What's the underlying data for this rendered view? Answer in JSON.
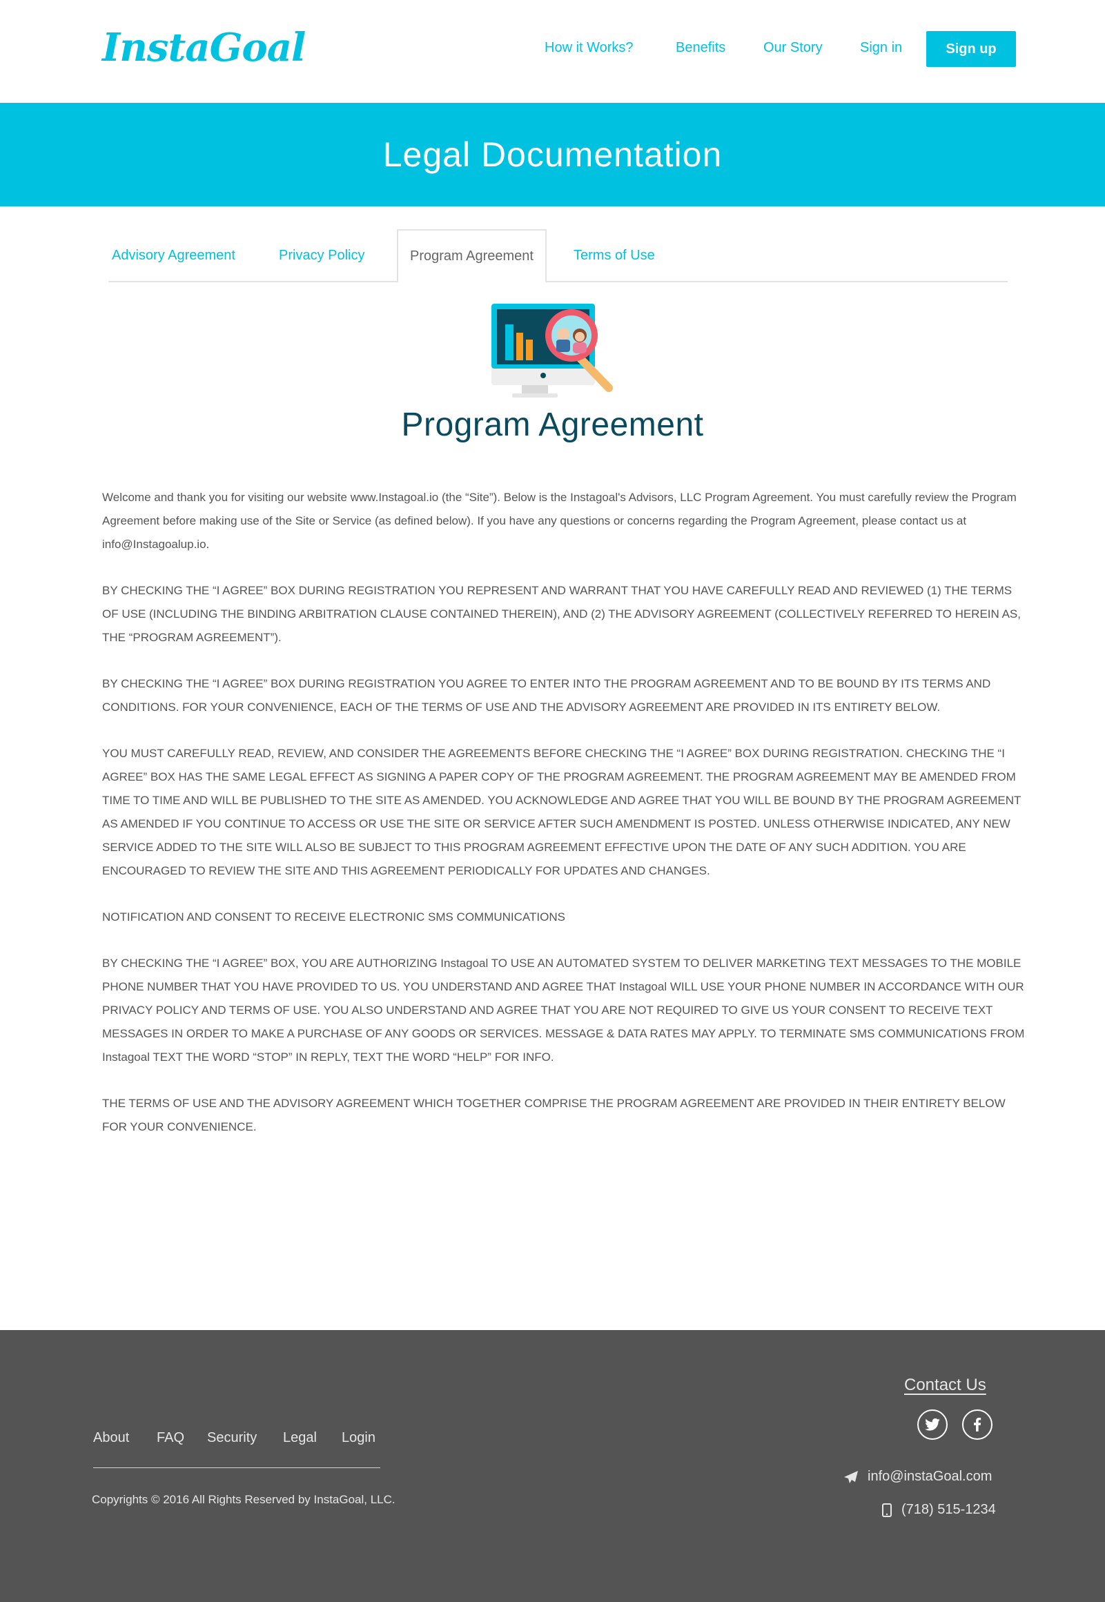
{
  "header": {
    "logo": "InstaGoal",
    "nav": [
      "How it Works?",
      "Benefits",
      "Our Story",
      "Sign in"
    ],
    "signup_label": "Sign up"
  },
  "banner": {
    "title": "Legal Documentation"
  },
  "tabs": [
    {
      "label": "Advisory Agreement",
      "active": false
    },
    {
      "label": "Privacy Policy",
      "active": false
    },
    {
      "label": "Program Agreement",
      "active": true
    },
    {
      "label": "Terms of Use",
      "active": false
    }
  ],
  "document": {
    "title": "Program Agreement",
    "paragraphs": [
      "Welcome and thank you for visiting our website www.Instagoal.io (the “Site”). Below is the Instagoal's Advisors, LLC Program Agreement. You must carefully review the Program Agreement before making use of the Site or Service (as defined below). If you have any questions or concerns regarding the Program Agreement, please contact us at info@Instagoalup.io.",
      "BY CHECKING THE “I AGREE” BOX DURING REGISTRATION YOU REPRESENT AND WARRANT THAT YOU HAVE CAREFULLY READ AND REVIEWED (1) THE TERMS OF USE (INCLUDING THE BINDING ARBITRATION CLAUSE CONTAINED THEREIN), AND (2) THE ADVISORY AGREEMENT (COLLECTIVELY REFERRED TO HEREIN AS, THE “PROGRAM AGREEMENT”).",
      "BY CHECKING THE “I AGREE” BOX DURING REGISTRATION YOU AGREE TO ENTER INTO THE PROGRAM AGREEMENT AND TO BE BOUND BY ITS TERMS AND CONDITIONS. FOR YOUR CONVENIENCE, EACH OF THE TERMS OF USE AND THE ADVISORY AGREEMENT ARE PROVIDED IN ITS ENTIRETY BELOW.",
      "YOU MUST CAREFULLY READ, REVIEW, AND CONSIDER THE AGREEMENTS BEFORE CHECKING THE “I AGREE” BOX DURING REGISTRATION. CHECKING THE “I AGREE” BOX HAS THE SAME LEGAL EFFECT AS SIGNING A PAPER COPY OF THE PROGRAM AGREEMENT. THE PROGRAM AGREEMENT MAY BE AMENDED FROM TIME TO TIME AND WILL BE PUBLISHED TO THE SITE AS AMENDED. YOU ACKNOWLEDGE AND AGREE THAT YOU WILL BE BOUND BY THE PROGRAM AGREEMENT AS AMENDED IF YOU CONTINUE TO ACCESS OR USE THE SITE OR SERVICE AFTER SUCH AMENDMENT IS POSTED. UNLESS OTHERWISE INDICATED, ANY NEW SERVICE ADDED TO THE SITE WILL ALSO BE SUBJECT TO THIS PROGRAM AGREEMENT EFFECTIVE UPON THE DATE OF ANY SUCH ADDITION. YOU ARE ENCOURAGED TO REVIEW THE SITE AND THIS AGREEMENT PERIODICALLY FOR UPDATES AND CHANGES.",
      "NOTIFICATION AND CONSENT TO RECEIVE ELECTRONIC SMS COMMUNICATIONS",
      "BY CHECKING THE “I AGREE” BOX, YOU ARE AUTHORIZING Instagoal TO USE AN AUTOMATED SYSTEM TO DELIVER MARKETING TEXT MESSAGES TO THE MOBILE PHONE NUMBER THAT YOU HAVE PROVIDED TO US. YOU UNDERSTAND AND AGREE THAT Instagoal WILL USE YOUR PHONE NUMBER IN ACCORDANCE WITH OUR PRIVACY POLICY AND TERMS OF USE. YOU ALSO UNDERSTAND AND AGREE THAT YOU ARE NOT REQUIRED TO GIVE US YOUR CONSENT TO RECEIVE TEXT MESSAGES IN ORDER TO MAKE A PURCHASE OF ANY GOODS OR SERVICES. MESSAGE & DATA RATES MAY APPLY. TO TERMINATE SMS COMMUNICATIONS FROM Instagoal TEXT THE WORD “STOP” IN REPLY, TEXT THE WORD “HELP” FOR INFO.",
      "THE TERMS OF USE AND THE ADVISORY AGREEMENT WHICH TOGETHER COMPRISE THE PROGRAM AGREEMENT ARE PROVIDED IN THEIR ENTIRETY BELOW FOR YOUR CONVENIENCE."
    ]
  },
  "footer": {
    "links": [
      "About",
      "FAQ",
      "Security",
      "Legal",
      "Login"
    ],
    "copyright": "Copyrights © 2016 All Rights Reserved by InstaGoal, LLC.",
    "contact_title": "Contact Us",
    "email": "info@instaGoal.com",
    "phone": "(718) 515-1234",
    "social": [
      "twitter-icon",
      "facebook-icon"
    ]
  },
  "colors": {
    "accent": "#00c2e0",
    "title": "#0b4a5c",
    "footer_bg": "#545454",
    "text": "#555555"
  }
}
